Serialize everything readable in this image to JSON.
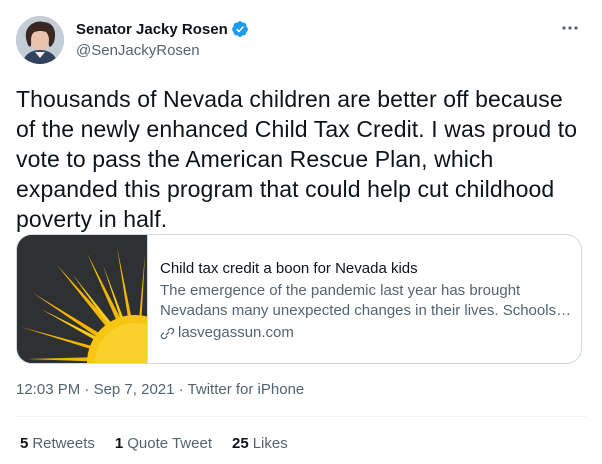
{
  "author": {
    "display_name": "Senator Jacky Rosen",
    "handle": "@SenJackyRosen",
    "verified": true
  },
  "tweet": {
    "text": "Thousands of Nevada children are better off because of the newly enhanced Child Tax Credit. I was proud to vote to pass the American Rescue Plan, which expanded this program that could help cut childhood poverty in half."
  },
  "card": {
    "title": "Child tax credit a boon for Nevada kids",
    "description_line1": "The emergence of the pandemic last year has brought",
    "description_line2": "Nevadans many unexpected changes in their lives. Schools …",
    "domain": "lasvegassun.com",
    "image_icon": "sun-illustration"
  },
  "meta": {
    "time": "12:03 PM",
    "separator": "·",
    "date": "Sep 7, 2021",
    "source": "Twitter for iPhone"
  },
  "stats": [
    {
      "count": "5",
      "label": "Retweets"
    },
    {
      "count": "1",
      "label": "Quote Tweet"
    },
    {
      "count": "25",
      "label": "Likes"
    }
  ],
  "colors": {
    "verified": "#1d9bf0",
    "secondary_text": "#536471",
    "primary_text": "#0f1419",
    "border": "#cfd9de",
    "sun_yellow": "#f5c518"
  }
}
